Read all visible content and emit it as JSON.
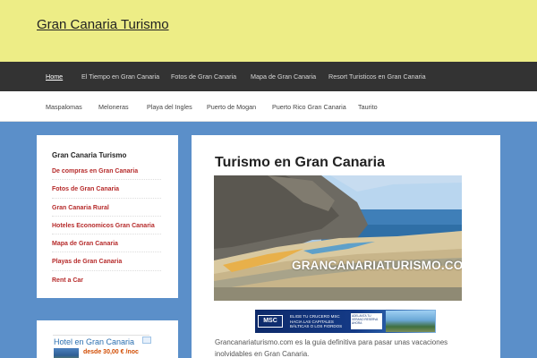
{
  "site": {
    "title": "Gran Canaria Turismo"
  },
  "nav_primary": {
    "items": [
      "Home",
      "El Tiempo en Gran Canaria",
      "Fotos de Gran Canaria",
      "Mapa de Gran Canaria",
      "Resort Turisticos en Gran Canaria"
    ]
  },
  "nav_secondary": {
    "items": [
      "Maspalomas",
      "Meloneras",
      "Playa del Ingles",
      "Puerto de Mogan",
      "Puerto Rico Gran Canaria",
      "Taurito"
    ]
  },
  "sidebar": {
    "widget_title": "Gran Canaria Turismo",
    "links": [
      "De compras en Gran Canaria",
      "Fotos de Gran Canaria",
      "Gran Canaria Rural",
      "Hoteles Economicos Gran Canaria",
      "Mapa de Gran Canaria",
      "Playas de Gran Canaria",
      "Rent a Car"
    ],
    "ad": {
      "title": "Hotel en Gran Canaria",
      "price": "desde 30,00 € /noc"
    }
  },
  "main": {
    "title": "Turismo en Gran Canaria",
    "hero_caption": "GRANCANARIATURISMO.COM",
    "banner": {
      "logo": "MSC",
      "logo_sub": "CRUCEROS",
      "text": "ELIGE TU CRUCERO MSC HACIA LAS CAPITALES BÁLTICAS O LOS FIORDOS",
      "cta": "ADELANTA TU VERANO RESERVA AHORA"
    },
    "intro_text": "Grancanariaturismo.com es la guia definitiva para pasar unas vacaciones inolvidables en Gran Canaria."
  },
  "colors": {
    "header_bg": "#eded86",
    "nav_primary_bg": "#333333",
    "page_bg": "#5b8fc9",
    "link_red": "#b62b2b"
  }
}
